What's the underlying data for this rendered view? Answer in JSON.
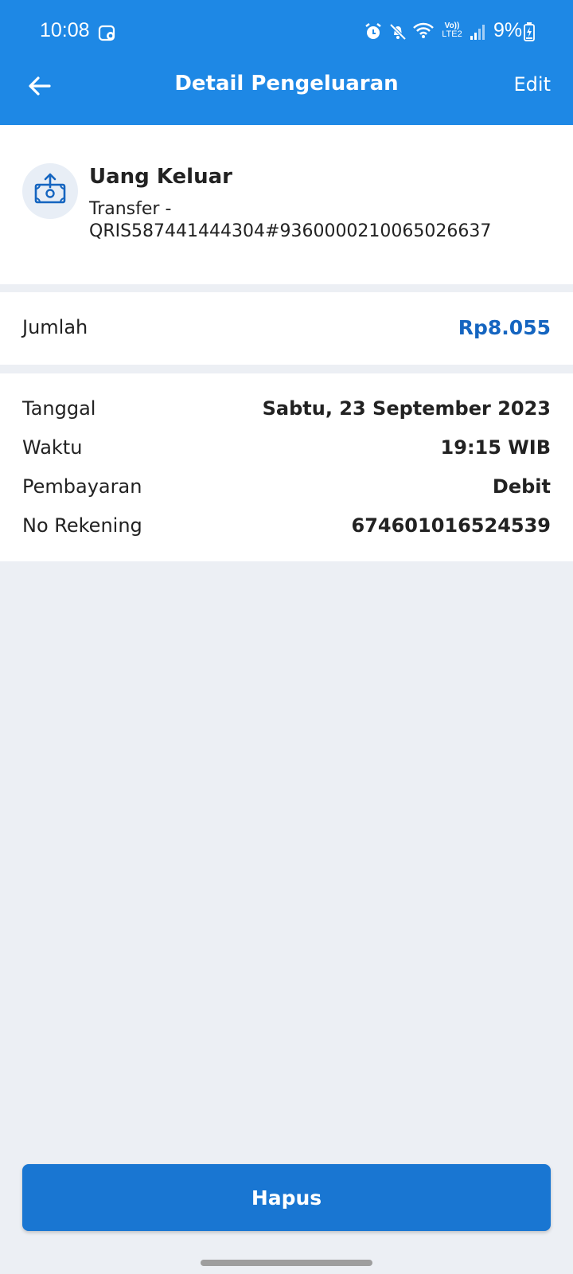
{
  "status_bar": {
    "time": "10:08",
    "battery": "9%",
    "icons": [
      "screen-record-icon",
      "alarm-icon",
      "mute-icon",
      "wifi-icon",
      "volte-lte2-icon",
      "signal-icon",
      "battery-charging-icon"
    ],
    "volte_text_top": "Vo))",
    "volte_text_bottom": "LTE2"
  },
  "header": {
    "title": "Detail Pengeluaran",
    "edit_label": "Edit",
    "color": "#1e88e5"
  },
  "transaction": {
    "icon": "money-out-icon",
    "title": "Uang Keluar",
    "description": "Transfer - QRIS587441444304#9360000210065026637"
  },
  "amount": {
    "label": "Jumlah",
    "value": "Rp8.055",
    "color": "#1565c0"
  },
  "details": [
    {
      "label": "Tanggal",
      "value": "Sabtu, 23 September 2023"
    },
    {
      "label": "Waktu",
      "value": "19:15 WIB"
    },
    {
      "label": "Pembayaran",
      "value": "Debit"
    },
    {
      "label": "No Rekening",
      "value": "674601016524539"
    }
  ],
  "delete_button": {
    "label": "Hapus",
    "color": "#1976d2"
  }
}
